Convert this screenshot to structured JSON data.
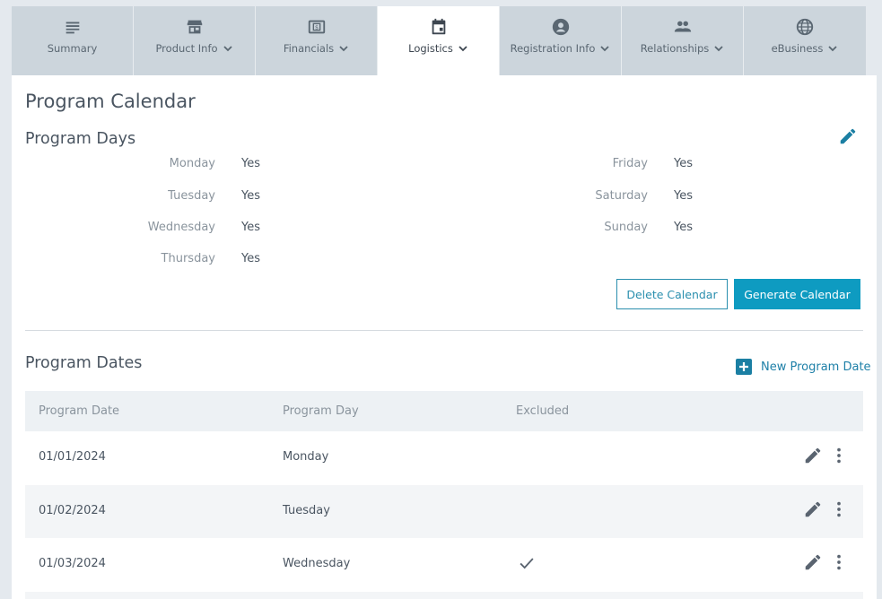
{
  "tabs": [
    {
      "label": "Summary",
      "icon": "summary-lines-icon",
      "has_dropdown": false
    },
    {
      "label": "Product Info",
      "icon": "store-icon",
      "has_dropdown": true
    },
    {
      "label": "Financials",
      "icon": "money-icon",
      "has_dropdown": true
    },
    {
      "label": "Logistics",
      "icon": "calendar-icon",
      "has_dropdown": true,
      "active": true
    },
    {
      "label": "Registration Info",
      "icon": "account-circle-icon",
      "has_dropdown": true
    },
    {
      "label": "Relationships",
      "icon": "people-icon",
      "has_dropdown": true
    },
    {
      "label": "eBusiness",
      "icon": "globe-icon",
      "has_dropdown": true
    }
  ],
  "page_title": "Program Calendar",
  "program_days": {
    "title": "Program Days",
    "left": [
      {
        "day": "Monday",
        "value": "Yes"
      },
      {
        "day": "Tuesday",
        "value": "Yes"
      },
      {
        "day": "Wednesday",
        "value": "Yes"
      },
      {
        "day": "Thursday",
        "value": "Yes"
      }
    ],
    "right": [
      {
        "day": "Friday",
        "value": "Yes"
      },
      {
        "day": "Saturday",
        "value": "Yes"
      },
      {
        "day": "Sunday",
        "value": "Yes"
      }
    ]
  },
  "buttons": {
    "delete_calendar": "Delete Calendar",
    "generate_calendar": "Generate Calendar"
  },
  "program_dates": {
    "title": "Program Dates",
    "new_label": "New Program Date",
    "columns": [
      "Program Date",
      "Program Day",
      "Excluded"
    ],
    "rows": [
      {
        "date": "01/01/2024",
        "day": "Monday",
        "excluded": false
      },
      {
        "date": "01/02/2024",
        "day": "Tuesday",
        "excluded": false
      },
      {
        "date": "01/03/2024",
        "day": "Wednesday",
        "excluded": true
      }
    ]
  },
  "colors": {
    "accent": "#0e9bc1",
    "link": "#1f80a8",
    "tab_bg": "#ccd5dc",
    "page_bg": "#e4e9ee"
  }
}
